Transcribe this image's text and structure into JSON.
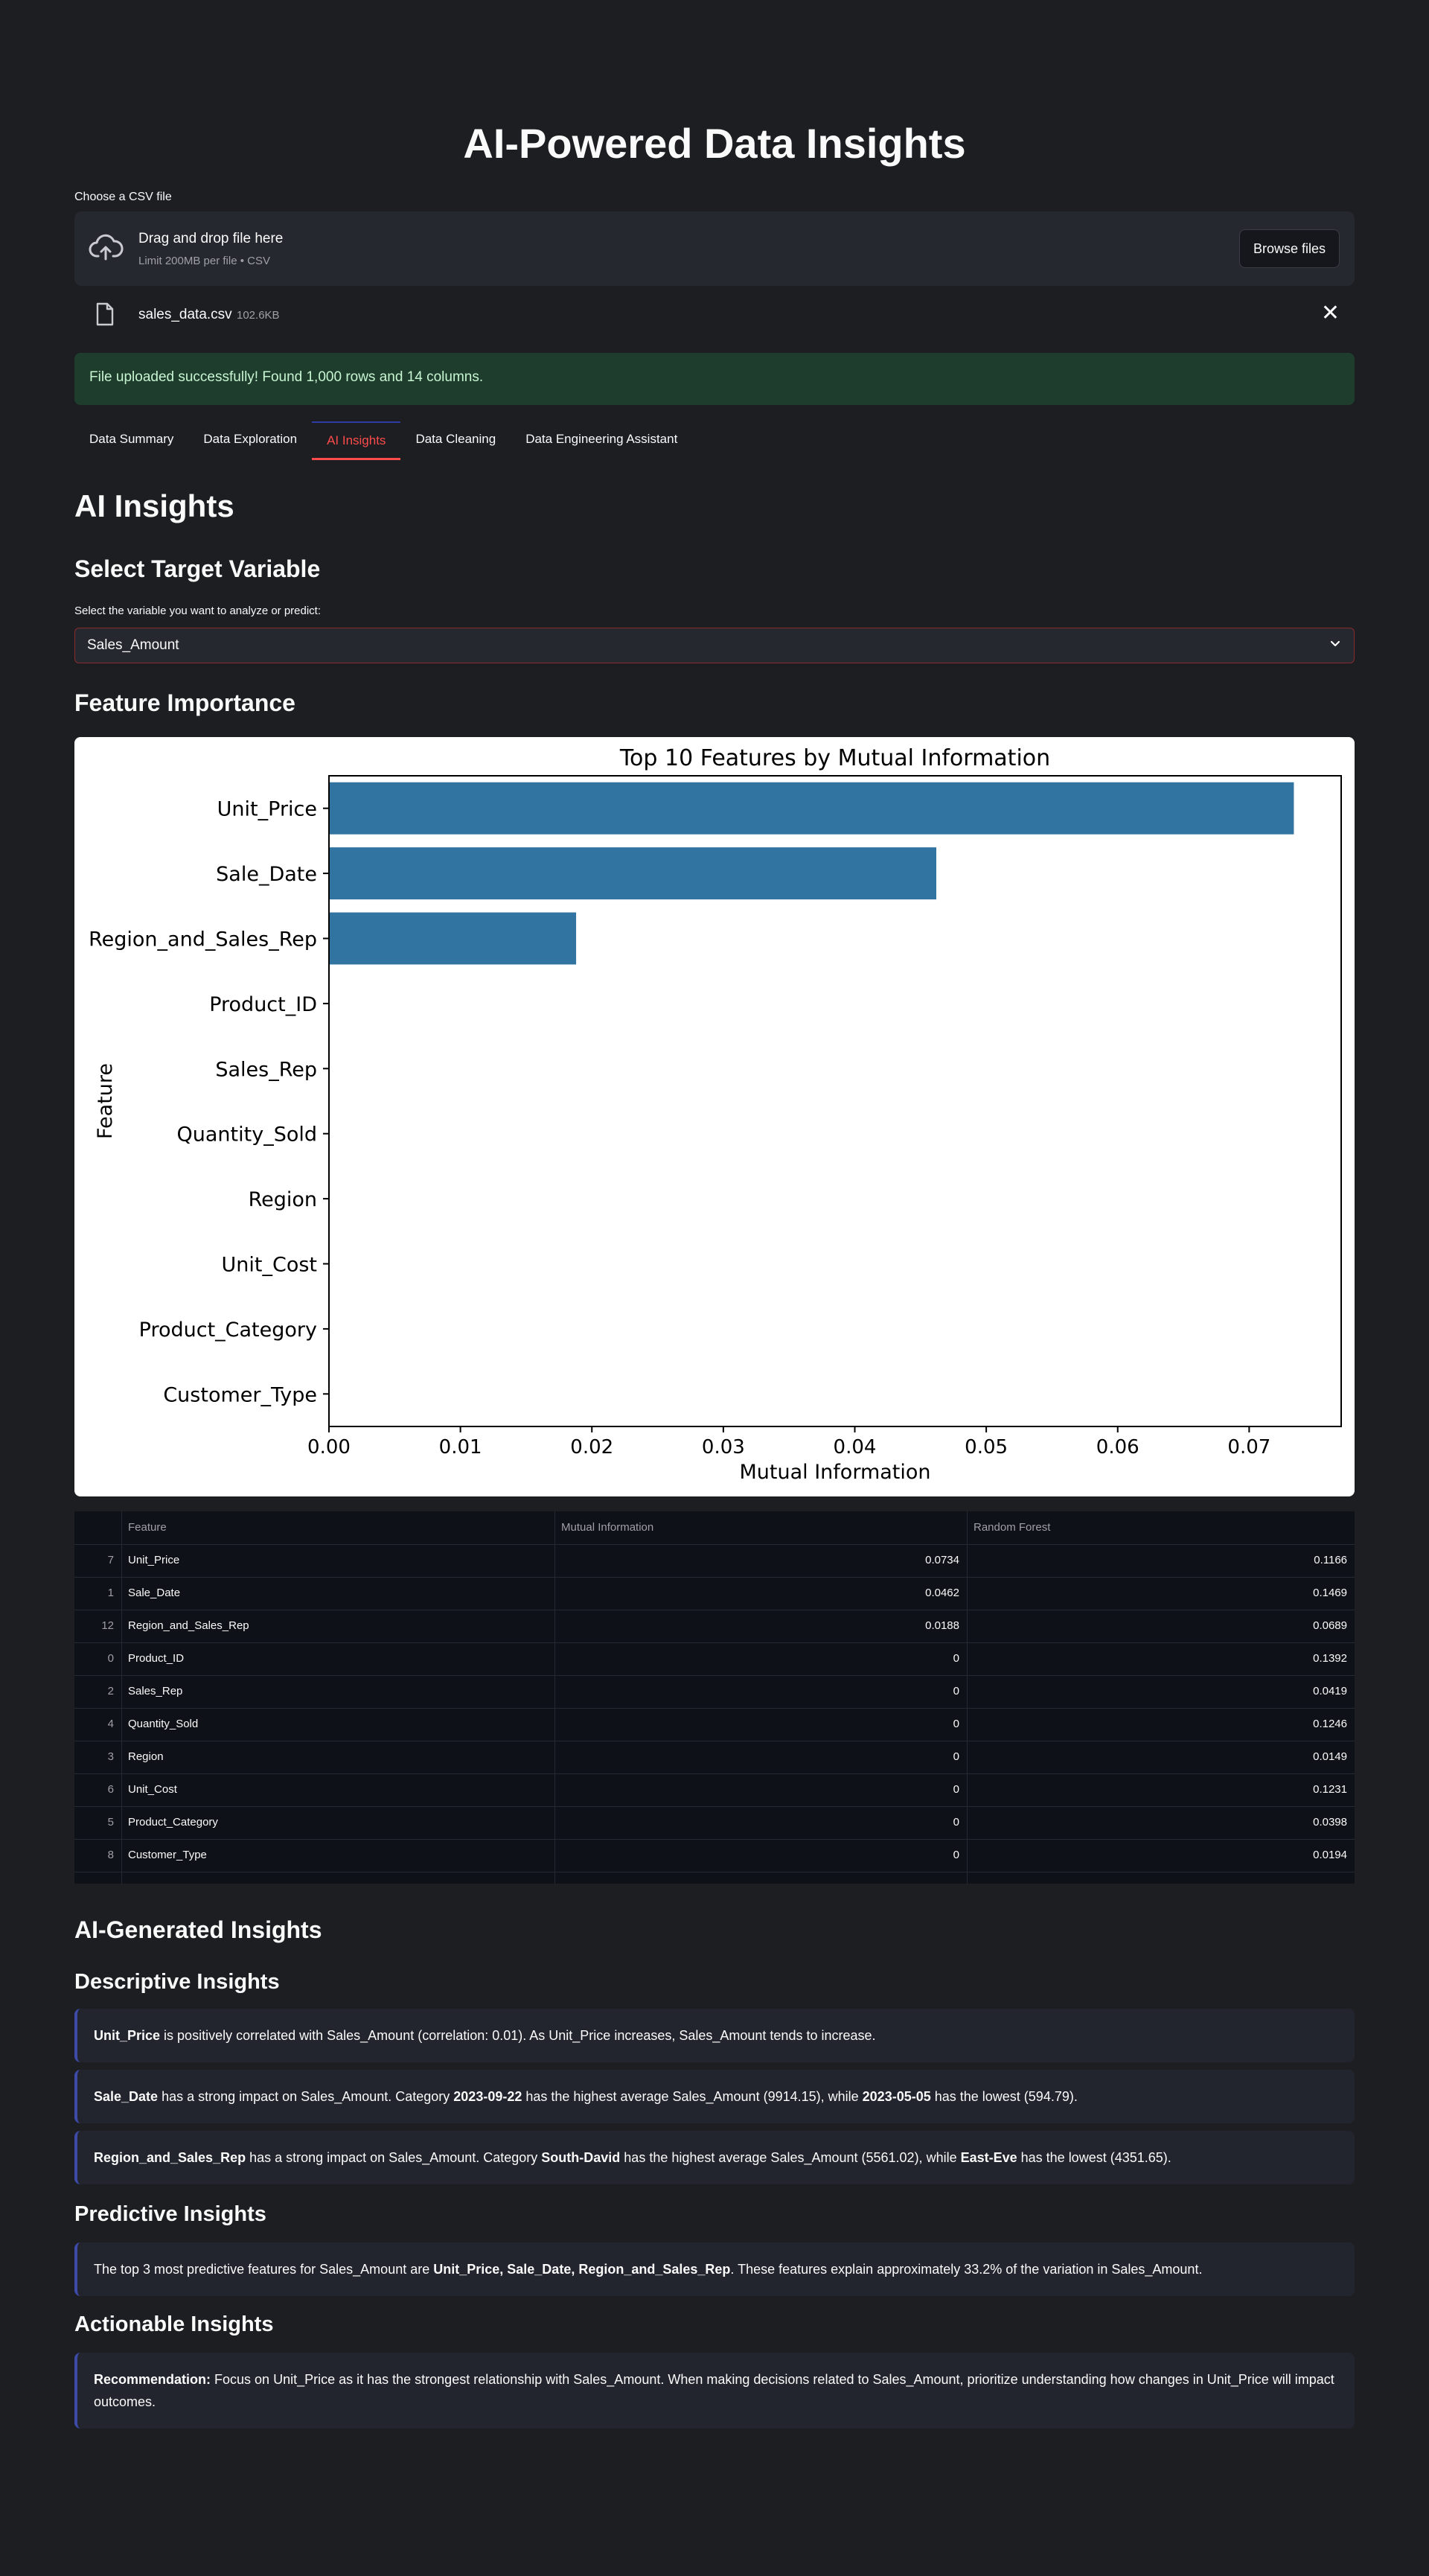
{
  "app": {
    "title": "AI-Powered Data Insights"
  },
  "uploader": {
    "label": "Choose a CSV file",
    "drop_title": "Drag and drop file here",
    "drop_sub": "Limit 200MB per file • CSV",
    "browse_label": "Browse files",
    "file_name": "sales_data.csv",
    "file_size": "102.6KB"
  },
  "alert": {
    "text": "File uploaded successfully! Found 1,000 rows and 14 columns."
  },
  "tabs": [
    {
      "label": "Data Summary",
      "active": false
    },
    {
      "label": "Data Exploration",
      "active": false
    },
    {
      "label": "AI Insights",
      "active": true
    },
    {
      "label": "Data Cleaning",
      "active": false
    },
    {
      "label": "Data Engineering Assistant",
      "active": false
    }
  ],
  "section": {
    "title": "AI Insights",
    "target_heading": "Select Target Variable",
    "select_label": "Select the variable you want to analyze or predict:",
    "select_value": "Sales_Amount",
    "importance_heading": "Feature Importance"
  },
  "chart_data": {
    "type": "bar",
    "orientation": "horizontal",
    "title": "Top 10 Features by Mutual Information",
    "xlabel": "Mutual Information",
    "ylabel": "Feature",
    "categories": [
      "Unit_Price",
      "Sale_Date",
      "Region_and_Sales_Rep",
      "Product_ID",
      "Sales_Rep",
      "Quantity_Sold",
      "Region",
      "Unit_Cost",
      "Product_Category",
      "Customer_Type"
    ],
    "values": [
      0.0734,
      0.0462,
      0.0188,
      0,
      0,
      0,
      0,
      0,
      0,
      0
    ],
    "xlim": [
      0,
      0.077
    ],
    "xticks": [
      "0.00",
      "0.01",
      "0.02",
      "0.03",
      "0.04",
      "0.05",
      "0.06",
      "0.07"
    ],
    "bar_color": "#3274a1",
    "grid": false
  },
  "table": {
    "columns": [
      "Feature",
      "Mutual Information",
      "Random Forest"
    ],
    "rows": [
      {
        "idx": "7",
        "feature": "Unit_Price",
        "mi": "0.0734",
        "rf": "0.1166"
      },
      {
        "idx": "1",
        "feature": "Sale_Date",
        "mi": "0.0462",
        "rf": "0.1469"
      },
      {
        "idx": "12",
        "feature": "Region_and_Sales_Rep",
        "mi": "0.0188",
        "rf": "0.0689"
      },
      {
        "idx": "0",
        "feature": "Product_ID",
        "mi": "0",
        "rf": "0.1392"
      },
      {
        "idx": "2",
        "feature": "Sales_Rep",
        "mi": "0",
        "rf": "0.0419"
      },
      {
        "idx": "4",
        "feature": "Quantity_Sold",
        "mi": "0",
        "rf": "0.1246"
      },
      {
        "idx": "3",
        "feature": "Region",
        "mi": "0",
        "rf": "0.0149"
      },
      {
        "idx": "6",
        "feature": "Unit_Cost",
        "mi": "0",
        "rf": "0.1231"
      },
      {
        "idx": "5",
        "feature": "Product_Category",
        "mi": "0",
        "rf": "0.0398"
      },
      {
        "idx": "8",
        "feature": "Customer_Type",
        "mi": "0",
        "rf": "0.0194"
      }
    ]
  },
  "insights": {
    "heading": "AI-Generated Insights",
    "descriptive_heading": "Descriptive Insights",
    "descriptive": [
      {
        "b1": "Unit_Price",
        "t1": " is positively correlated with Sales_Amount (correlation: 0.01). As Unit_Price increases, Sales_Amount tends to increase."
      },
      {
        "b1": "Sale_Date",
        "t1": " has a strong impact on Sales_Amount. Category ",
        "b2": "2023-09-22",
        "t2": " has the highest average Sales_Amount (9914.15), while ",
        "b3": "2023-05-05",
        "t3": " has the lowest (594.79)."
      },
      {
        "b1": "Region_and_Sales_Rep",
        "t1": " has a strong impact on Sales_Amount. Category ",
        "b2": "South-David",
        "t2": " has the highest average Sales_Amount (5561.02), while ",
        "b3": "East-Eve",
        "t3": " has the lowest (4351.65)."
      }
    ],
    "predictive_heading": "Predictive Insights",
    "predictive": {
      "t1": "The top 3 most predictive features for Sales_Amount are ",
      "b1": "Unit_Price, Sale_Date, Region_and_Sales_Rep",
      "t2": ". These features explain approximately 33.2% of the variation in Sales_Amount."
    },
    "actionable_heading": "Actionable Insights",
    "actionable": {
      "b1": "Recommendation:",
      "t1": " Focus on Unit_Price as it has the strongest relationship with Sales_Amount. When making decisions related to Sales_Amount, prioritize understanding how changes in Unit_Price will impact outcomes."
    }
  }
}
